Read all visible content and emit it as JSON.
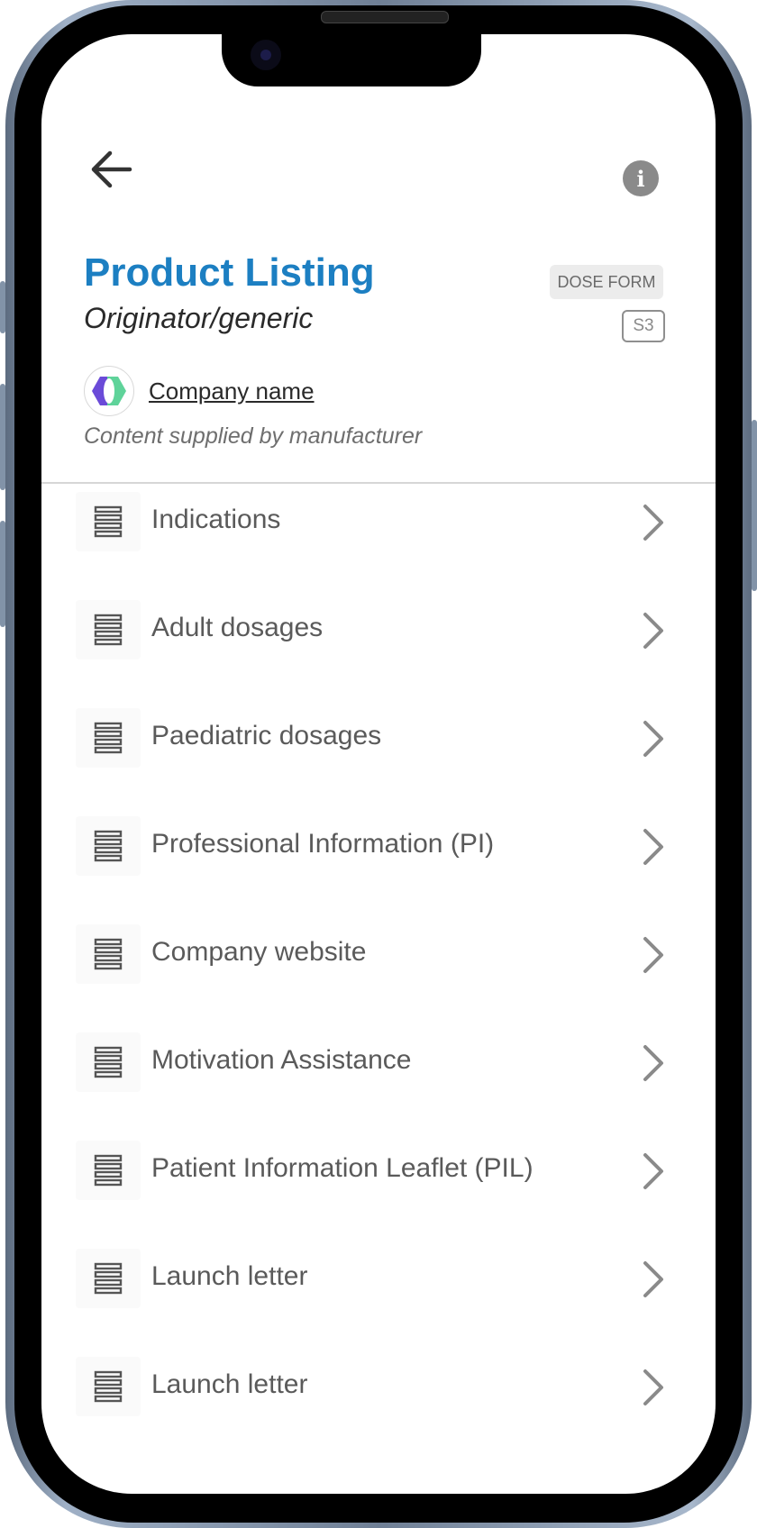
{
  "header": {
    "back_icon": "arrow-left-icon",
    "info_icon": "info-icon",
    "info_glyph": "i"
  },
  "product": {
    "title": "Product Listing",
    "subtitle": "Originator/generic",
    "dose_form_badge": "DOSE FORM",
    "schedule_badge": "S3",
    "company_name": "Company name",
    "supplied_note": "Content supplied by manufacturer"
  },
  "menu": {
    "items": [
      {
        "label": "Indications",
        "icon": "document-stack-icon"
      },
      {
        "label": "Adult dosages",
        "icon": "document-stack-icon"
      },
      {
        "label": "Paediatric dosages",
        "icon": "document-stack-icon"
      },
      {
        "label": "Professional Information (PI)",
        "icon": "document-stack-icon"
      },
      {
        "label": "Company website",
        "icon": "document-stack-icon"
      },
      {
        "label": "Motivation Assistance",
        "icon": "document-stack-icon"
      },
      {
        "label": "Patient Information Leaflet (PIL)",
        "icon": "document-stack-icon"
      },
      {
        "label": "Launch letter",
        "icon": "document-stack-icon"
      },
      {
        "label": "Launch letter",
        "icon": "document-stack-icon"
      }
    ]
  },
  "colors": {
    "title_blue": "#1c7fc2",
    "logo_purple": "#6b4bd8",
    "logo_green": "#5fd39a"
  }
}
